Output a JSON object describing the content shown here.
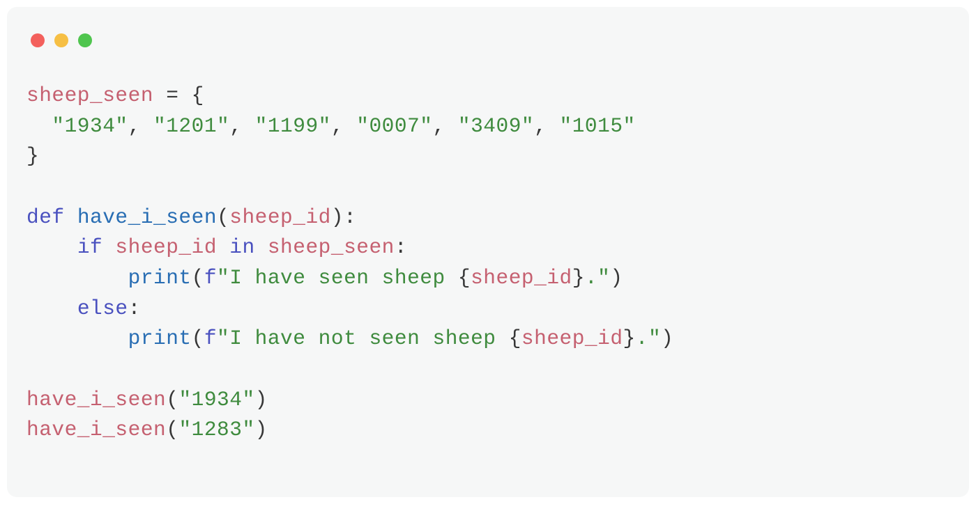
{
  "colors": {
    "bg": "#f6f7f7",
    "traffic_red": "#f3605c",
    "traffic_yellow": "#f6bf44",
    "traffic_green": "#4fc54e",
    "syntax_var": "#c56070",
    "syntax_string": "#3f8b3e",
    "syntax_keyword": "#4a51bf",
    "syntax_func": "#286db3",
    "syntax_default": "#373737"
  },
  "code": {
    "line1_var": "sheep_seen",
    "line1_eq": " = ",
    "line1_open": "{",
    "line2_indent": "  ",
    "line2_s1": "\"1934\"",
    "line2_c1": ", ",
    "line2_s2": "\"1201\"",
    "line2_c2": ", ",
    "line2_s3": "\"1199\"",
    "line2_c3": ", ",
    "line2_s4": "\"0007\"",
    "line2_c4": ", ",
    "line2_s5": "\"3409\"",
    "line2_c5": ", ",
    "line2_s6": "\"1015\"",
    "line3_close": "}",
    "line5_def": "def",
    "line5_sp": " ",
    "line5_name": "have_i_seen",
    "line5_lp": "(",
    "line5_param": "sheep_id",
    "line5_rp": "):",
    "line6_indent": "    ",
    "line6_if": "if",
    "line6_sp1": " ",
    "line6_var": "sheep_id",
    "line6_sp2": " ",
    "line6_in": "in",
    "line6_sp3": " ",
    "line6_set": "sheep_seen",
    "line6_colon": ":",
    "line7_indent": "        ",
    "line7_print": "print",
    "line7_lp": "(",
    "line7_f": "f",
    "line7_q1": "\"",
    "line7_txt": "I have seen sheep ",
    "line7_lb": "{",
    "line7_interp": "sheep_id",
    "line7_rb": "}",
    "line7_dot": ".",
    "line7_q2": "\"",
    "line7_rp": ")",
    "line8_indent": "    ",
    "line8_else": "else",
    "line8_colon": ":",
    "line9_indent": "        ",
    "line9_print": "print",
    "line9_lp": "(",
    "line9_f": "f",
    "line9_q1": "\"",
    "line9_txt": "I have not seen sheep ",
    "line9_lb": "{",
    "line9_interp": "sheep_id",
    "line9_rb": "}",
    "line9_dot": ".",
    "line9_q2": "\"",
    "line9_rp": ")",
    "line11_call": "have_i_seen",
    "line11_lp": "(",
    "line11_arg": "\"1934\"",
    "line11_rp": ")",
    "line12_call": "have_i_seen",
    "line12_lp": "(",
    "line12_arg": "\"1283\"",
    "line12_rp": ")"
  }
}
